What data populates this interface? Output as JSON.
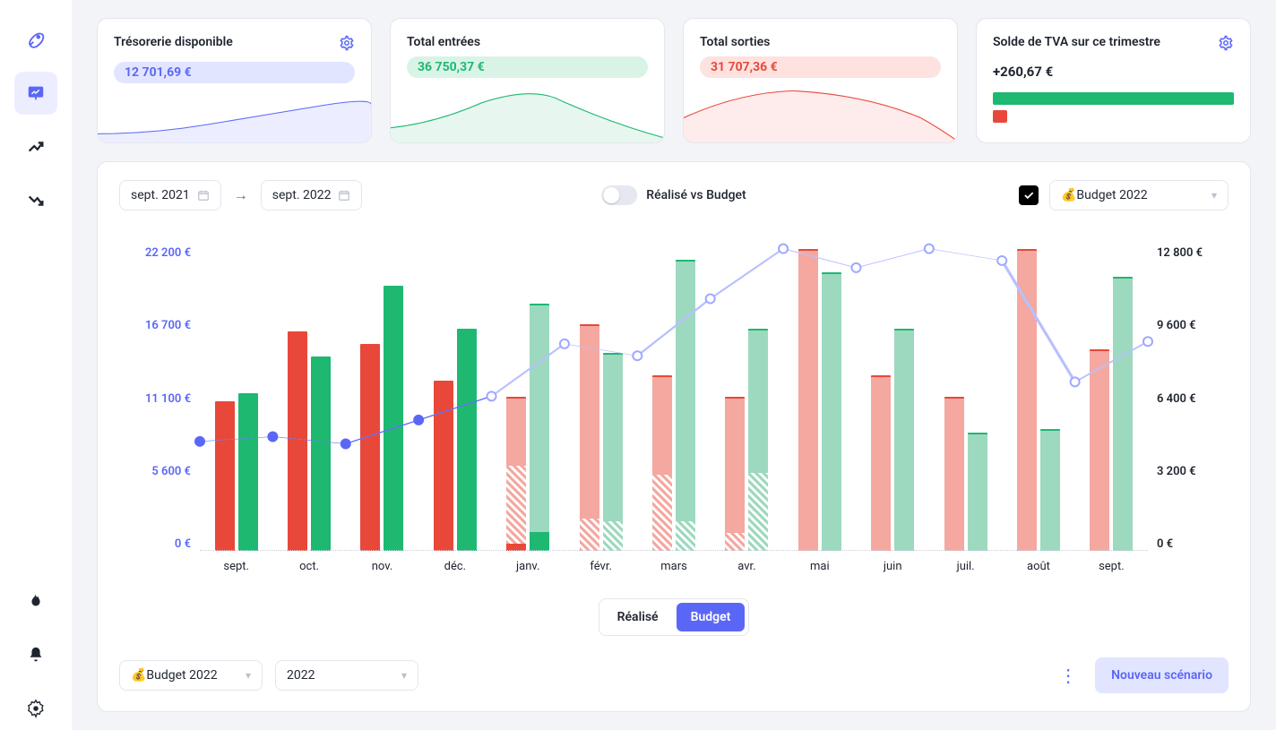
{
  "sidebar": {
    "items": [
      {
        "name": "rocket",
        "active": false
      },
      {
        "name": "dashboard",
        "active": true
      },
      {
        "name": "trend-up",
        "active": false
      },
      {
        "name": "trend-down",
        "active": false
      },
      {
        "name": "flame",
        "active": false
      },
      {
        "name": "bell",
        "active": false
      },
      {
        "name": "settings",
        "active": false
      }
    ]
  },
  "cards": {
    "tresorerie": {
      "title": "Trésorerie disponible",
      "value": "12 701,69 €"
    },
    "entrees": {
      "title": "Total entrées",
      "value": "36 750,37 €"
    },
    "sorties": {
      "title": "Total sorties",
      "value": "31 707,36 €"
    },
    "tva": {
      "title": "Solde de TVA sur ce trimestre",
      "value": "+260,67 €"
    }
  },
  "colors": {
    "accent": "#5a67f6",
    "green": "#1eb871",
    "red": "#e8483a",
    "green_light": "#9dd9be",
    "red_light": "#f4a8a0"
  },
  "filters": {
    "date_from": "sept. 2021",
    "date_to": "sept. 2022",
    "toggle_label": "Réalisé vs Budget",
    "budget_select": "💰Budget 2022"
  },
  "segmented": {
    "realise": "Réalisé",
    "budget": "Budget",
    "active": "budget"
  },
  "footer": {
    "budget_select": "💰Budget 2022",
    "year_select": "2022",
    "new_scenario": "Nouveau scénario"
  },
  "chart_data": {
    "type": "bar",
    "title": "",
    "xlabel": "",
    "ylabel": "",
    "y_left_ticks": [
      "22 200 €",
      "16 700 €",
      "11 100 €",
      "5 600 €",
      "0 €"
    ],
    "y_right_ticks": [
      "12 800 €",
      "9 600 €",
      "6 400 €",
      "3 200 €",
      "0 €"
    ],
    "y_left_max": 22200,
    "y_right_max": 12800,
    "categories": [
      "sept.",
      "oct.",
      "nov.",
      "déc.",
      "janv.",
      "févr.",
      "mars",
      "avr.",
      "mai",
      "juin",
      "juil.",
      "août",
      "sept."
    ],
    "series": [
      {
        "name": "Sorties réalisé (rouge plein)",
        "role": "realised_out",
        "kind": "solid_red",
        "values": [
          10900,
          16000,
          15100,
          12400,
          null,
          null,
          null,
          null,
          null,
          null,
          null,
          null,
          null
        ]
      },
      {
        "name": "Entrées réalisé (vert plein)",
        "role": "realised_in",
        "kind": "solid_green",
        "values": [
          11500,
          14200,
          19300,
          16200,
          null,
          null,
          null,
          null,
          null,
          null,
          null,
          null,
          null
        ]
      },
      {
        "name": "Sorties budget (rouge clair)",
        "role": "budget_out_light",
        "kind": "light_red",
        "values": [
          null,
          null,
          null,
          null,
          11200,
          16500,
          12800,
          11200,
          22000,
          12800,
          11200,
          22000,
          14700
        ]
      },
      {
        "name": "Entrées budget (vert clair)",
        "role": "budget_in_light",
        "kind": "light_green",
        "values": [
          null,
          null,
          null,
          null,
          18000,
          14400,
          21200,
          16200,
          20300,
          16200,
          8600,
          8900,
          20000
        ]
      },
      {
        "name": "Sorties réalisé partiel (hachuré rouge)",
        "role": "overlay_out_hatch",
        "kind": "hatch_red",
        "values": [
          null,
          null,
          null,
          null,
          5800,
          2400,
          5600,
          1300,
          null,
          null,
          null,
          null,
          null
        ]
      },
      {
        "name": "Sorties réalisé partiel (solide rouge)",
        "role": "overlay_out_solid",
        "kind": "solid_red_small",
        "values": [
          null,
          null,
          null,
          null,
          500,
          null,
          null,
          null,
          null,
          null,
          null,
          null,
          null
        ]
      },
      {
        "name": "Entrées réalisé partiel (hachuré vert)",
        "role": "overlay_in_hatch",
        "kind": "hatch_green",
        "values": [
          null,
          null,
          null,
          null,
          null,
          2200,
          2200,
          5700,
          null,
          null,
          null,
          null,
          null
        ]
      },
      {
        "name": "Entrées réalisé partiel (solide vert)",
        "role": "overlay_in_solid",
        "kind": "solid_green_small",
        "values": [
          null,
          null,
          null,
          null,
          1400,
          null,
          null,
          null,
          null,
          null,
          null,
          null,
          null
        ]
      },
      {
        "name": "Trésorerie (ligne)",
        "role": "treasury_line",
        "axis": "right",
        "values": [
          4600,
          4800,
          4500,
          5500,
          6500,
          8700,
          8200,
          10600,
          12700,
          11900,
          12700,
          12200,
          7100,
          8800
        ]
      }
    ]
  }
}
